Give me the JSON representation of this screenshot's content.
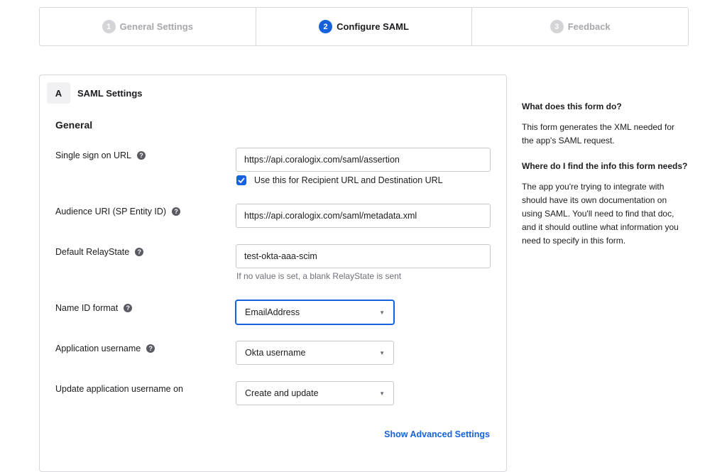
{
  "stepper": {
    "steps": [
      {
        "number": "1",
        "label": "General Settings",
        "active": false
      },
      {
        "number": "2",
        "label": "Configure SAML",
        "active": true
      },
      {
        "number": "3",
        "label": "Feedback",
        "active": false
      }
    ]
  },
  "panel": {
    "section_letter": "A",
    "section_title": "SAML Settings",
    "general_title": "General",
    "sso_url": {
      "label": "Single sign on URL",
      "value": "https://api.coralogix.com/saml/assertion",
      "checkbox_label": "Use this for Recipient URL and Destination URL",
      "checked": true
    },
    "audience_uri": {
      "label": "Audience URI (SP Entity ID)",
      "value": "https://api.coralogix.com/saml/metadata.xml"
    },
    "relay_state": {
      "label": "Default RelayState",
      "value": "test-okta-aaa-scim",
      "hint": "If no value is set, a blank RelayState is sent"
    },
    "name_id_format": {
      "label": "Name ID format",
      "value": "EmailAddress"
    },
    "app_username": {
      "label": "Application username",
      "value": "Okta username"
    },
    "update_username": {
      "label": "Update application username on",
      "value": "Create and update"
    },
    "advanced_link": "Show Advanced Settings"
  },
  "sidebar": {
    "q1": "What does this form do?",
    "a1": "This form generates the XML needed for the app's SAML request.",
    "q2": "Where do I find the info this form needs?",
    "a2": "The app you're trying to integrate with should have its own documentation on using SAML. You'll need to find that doc, and it should outline what information you need to specify in this form."
  },
  "colors": {
    "accent": "#1662dd",
    "border": "#d7d7dc"
  },
  "icons": {
    "help": "help-circle-icon",
    "check": "check-icon",
    "caret": "caret-down-icon"
  }
}
